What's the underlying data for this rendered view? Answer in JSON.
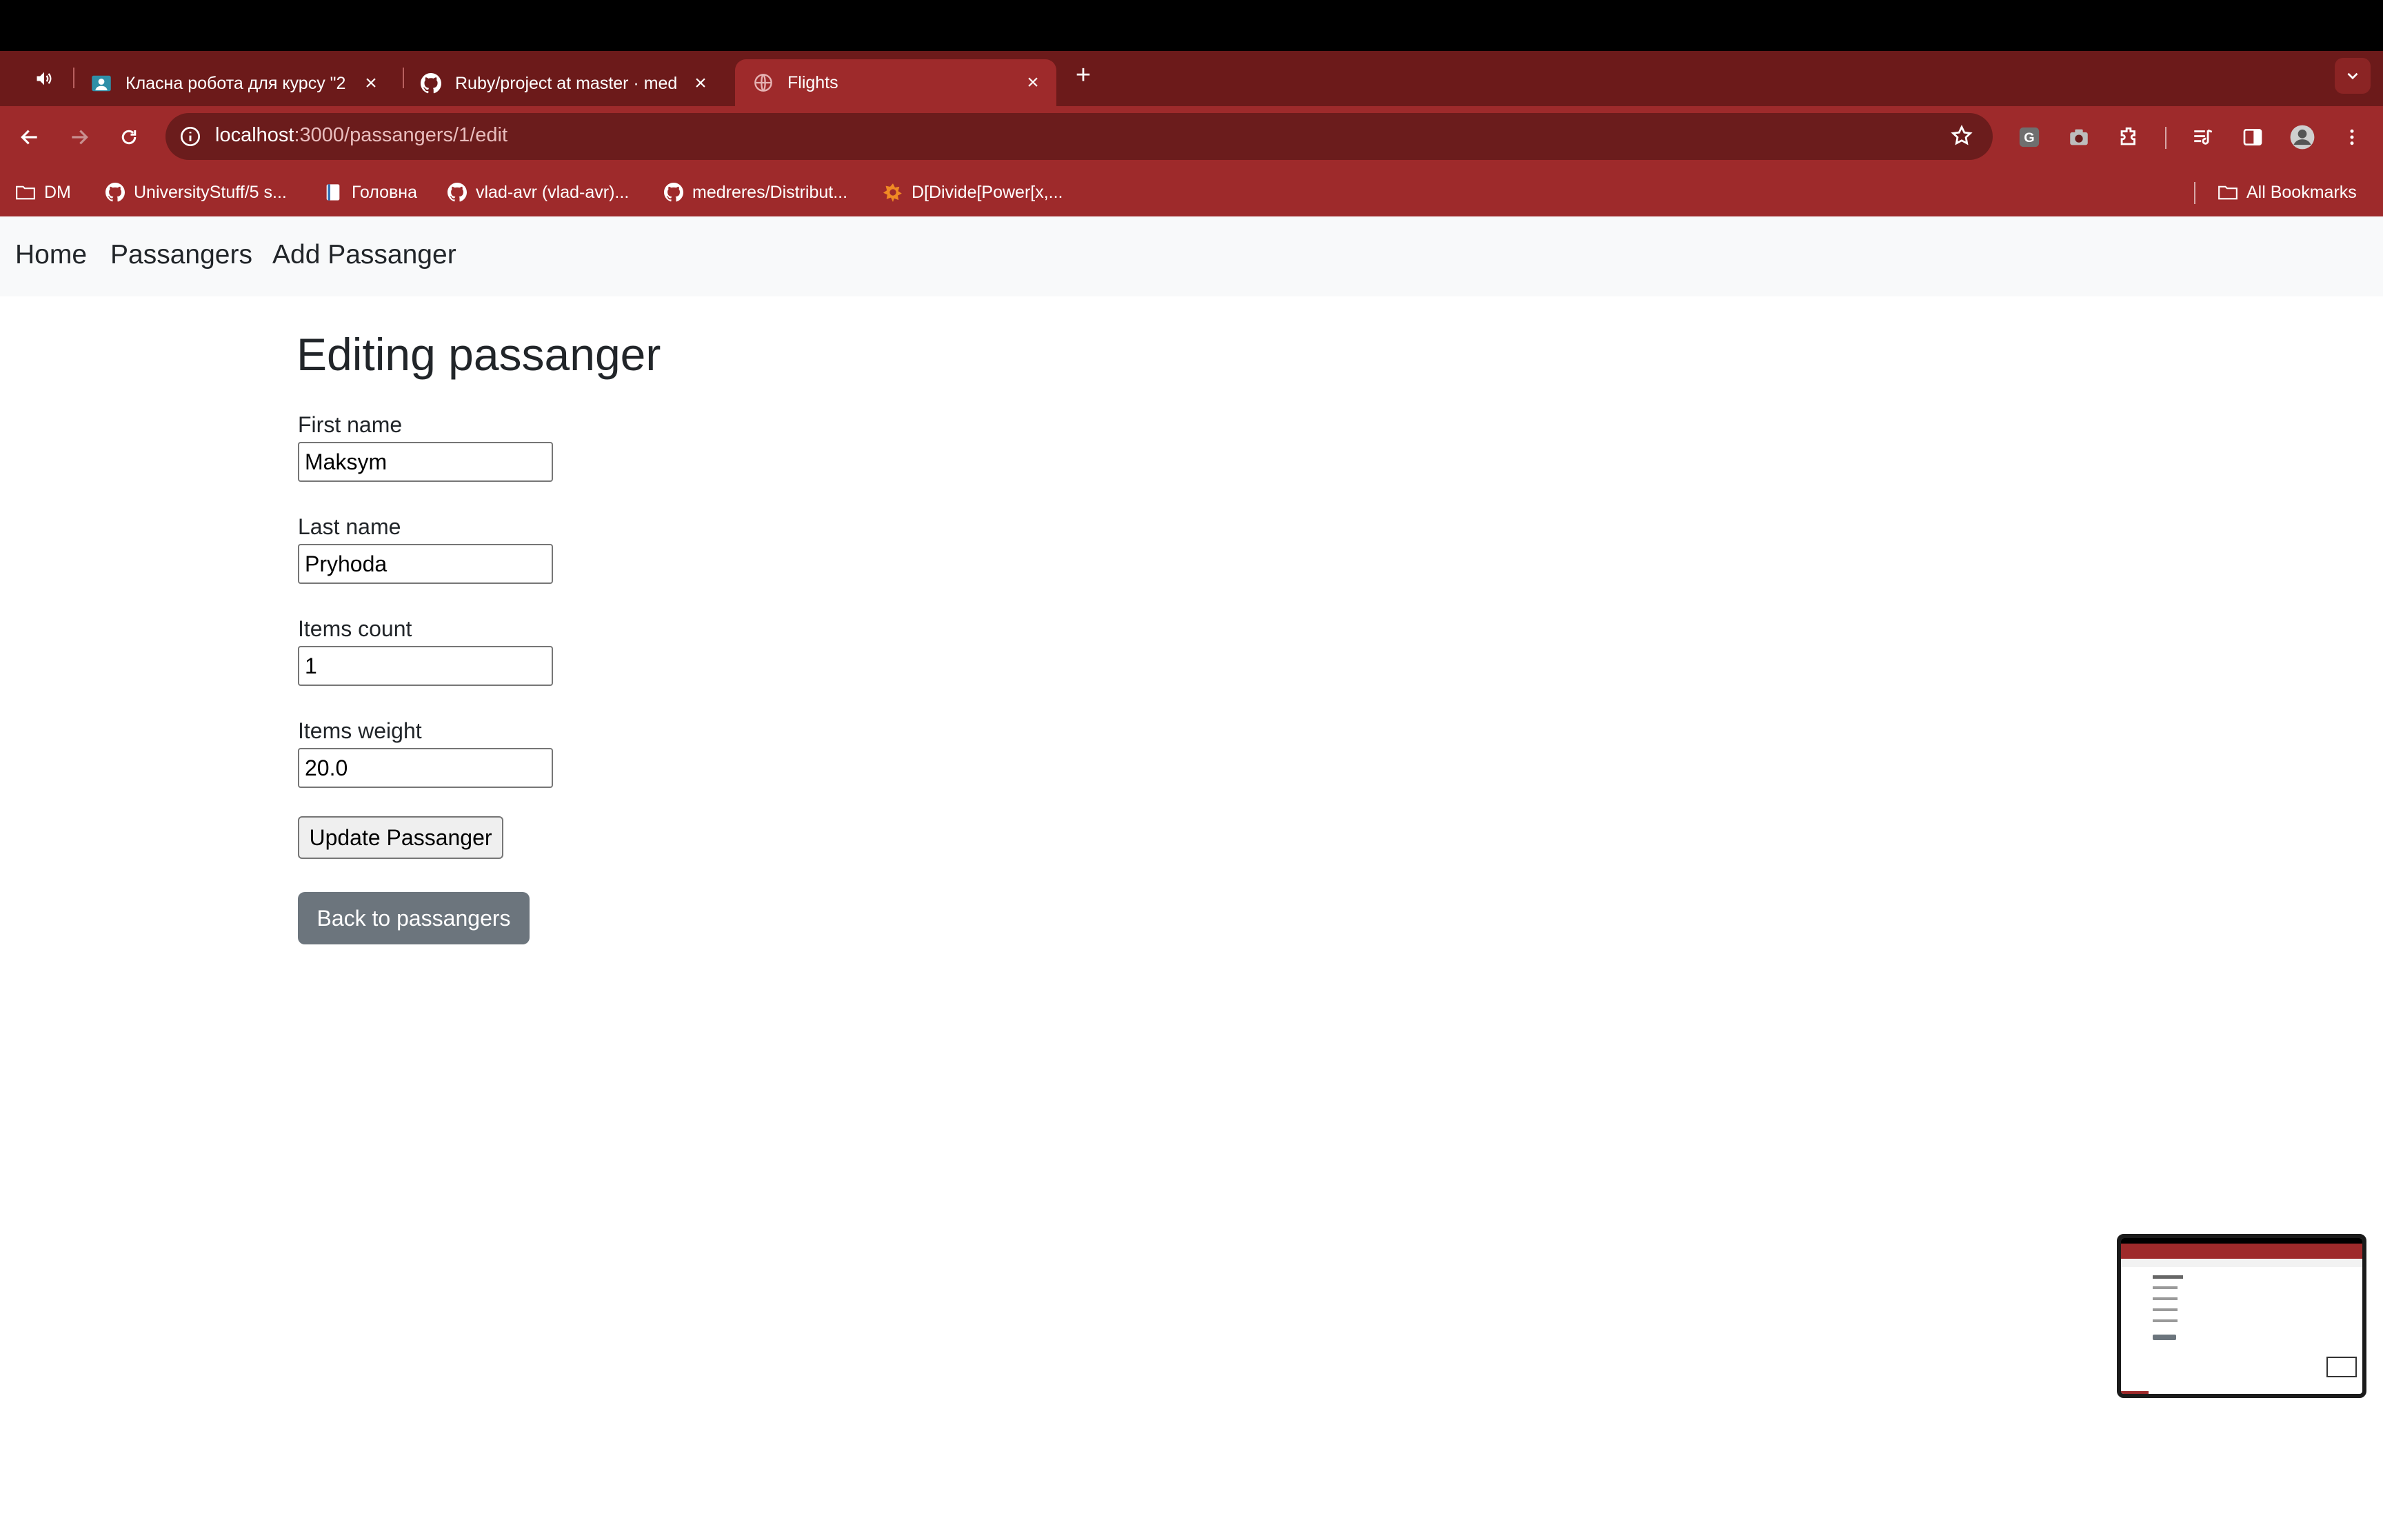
{
  "browser": {
    "tabs": [
      {
        "title": "Класна робота для курсу \"2",
        "favicon": "classroom-icon",
        "active": false
      },
      {
        "title": "Ruby/project at master · med",
        "favicon": "github-icon",
        "active": false
      },
      {
        "title": "Flights",
        "favicon": "globe-icon",
        "active": true
      }
    ],
    "address": {
      "host": "localhost",
      "rest": ":3000/passangers/1/edit"
    },
    "bookmarks": [
      {
        "label": "DM",
        "icon": "folder-icon"
      },
      {
        "label": "UniversityStuff/5 s...",
        "icon": "github-icon"
      },
      {
        "label": "Головна",
        "icon": "page-icon"
      },
      {
        "label": "vlad-avr (vlad-avr)...",
        "icon": "github-icon"
      },
      {
        "label": "medreres/Distribut...",
        "icon": "github-icon"
      },
      {
        "label": "D[Divide[Power[x,...",
        "icon": "wolfram-icon"
      }
    ],
    "all_bookmarks": "All Bookmarks",
    "colors": {
      "chrome": "#9e2a2b",
      "tabstrip": "#6c1a1a"
    }
  },
  "page": {
    "nav": {
      "home": "Home",
      "passangers": "Passangers",
      "add": "Add Passanger"
    },
    "heading": "Editing passanger",
    "form": {
      "first_name": {
        "label": "First name",
        "value": "Maksym"
      },
      "last_name": {
        "label": "Last name",
        "value": "Pryhoda"
      },
      "items_count": {
        "label": "Items count",
        "value": "1"
      },
      "items_weight": {
        "label": "Items weight",
        "value": "20.0"
      },
      "submit": "Update Passanger"
    },
    "back_link": "Back to passangers"
  }
}
